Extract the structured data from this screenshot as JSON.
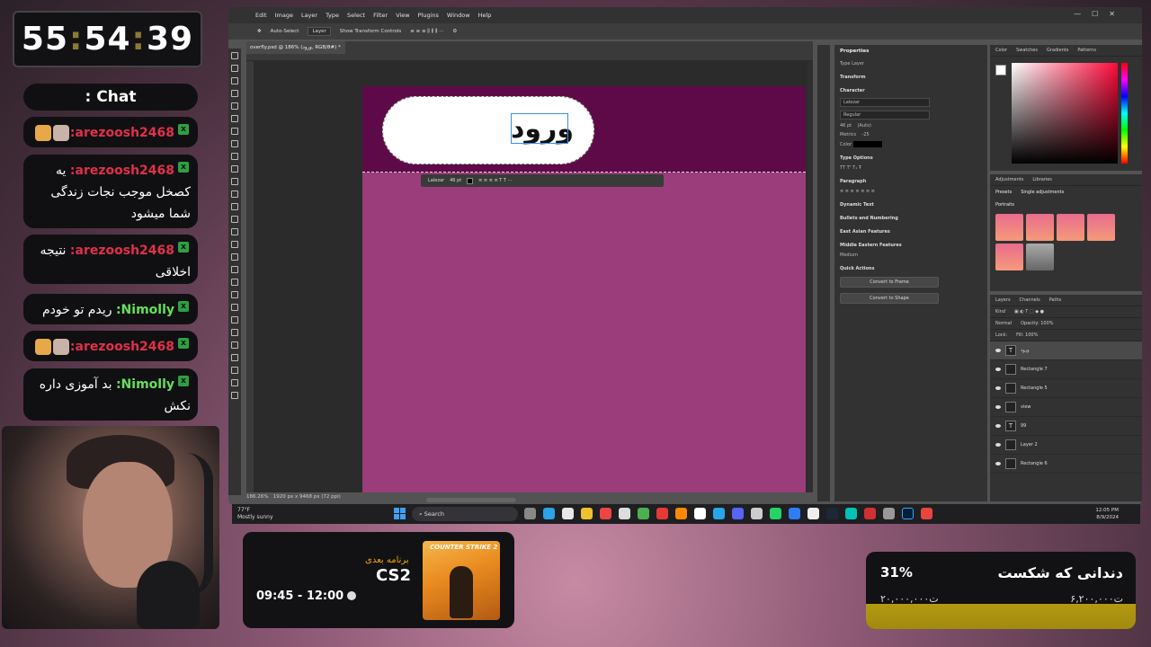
{
  "timer": {
    "h": "55",
    "m": "54",
    "s": "39"
  },
  "chat": {
    "title": ": Chat",
    "messages": [
      {
        "user": "arezoosh2468:",
        "text": "",
        "color": "red",
        "emojis": 2
      },
      {
        "user": "arezoosh2468:",
        "text": "یه کصخل موجب نجات زندگی شما میشود",
        "color": "red",
        "emojis": 0
      },
      {
        "user": "arezoosh2468:",
        "text": "نتیجه اخلاقی",
        "color": "red",
        "emojis": 0
      },
      {
        "user": "Nimolly:",
        "text": "ریدم تو خودم",
        "color": "green",
        "emojis": 0
      },
      {
        "user": "arezoosh2468:",
        "text": "",
        "color": "red",
        "emojis": 2
      },
      {
        "user": "Nimolly:",
        "text": "بد آموزی داره نکش",
        "color": "green",
        "emojis": 0
      }
    ]
  },
  "photoshop": {
    "menu": [
      "Edit",
      "Image",
      "Layer",
      "Type",
      "Select",
      "Filter",
      "View",
      "Plugins",
      "Window",
      "Help"
    ],
    "options": {
      "auto_select": "Auto-Select",
      "layer": "Layer",
      "transform": "Show Transform Controls"
    },
    "doc_tab": "overfly.psd @ 186% (ورود, RGB/8#) *",
    "status_zoom": "186.26%",
    "status_size": "1920 px x 9468 px (72 ppi)",
    "canvas_text": "ورود",
    "ctx_font": "Lalezar",
    "ctx_size": "46 pt",
    "properties": {
      "title": "Properties",
      "type_layer": "Type Layer",
      "transform": "Transform",
      "character": "Character",
      "font": "Lalezar",
      "style": "Regular",
      "size": "46 pt",
      "leading": "(Auto)",
      "kerning": "Metrics",
      "tracking": "-25",
      "color_label": "Color",
      "type_options": "Type Options",
      "paragraph": "Paragraph",
      "dynamic_text": "Dynamic Text",
      "bullets": "Bullets and Numbering",
      "east_asian": "East Asian Features",
      "middle_eastern": "Middle Eastern Features",
      "me_value": "Medium",
      "quick_actions": "Quick Actions",
      "convert_frame": "Convert to Frame",
      "convert_shape": "Convert to Shape"
    },
    "color_tabs": [
      "Color",
      "Swatches",
      "Gradients",
      "Patterns"
    ],
    "adj_tabs": [
      "Adjustments",
      "Libraries"
    ],
    "adj_sub": [
      "Presets",
      "Single adjustments"
    ],
    "portraits_label": "Portraits",
    "layers_tabs": [
      "Layers",
      "Channels",
      "Paths"
    ],
    "layers_kind": "Kind",
    "blend": "Normal",
    "opacity": "Opacity: 100%",
    "fill": "Fill: 100%",
    "lock": "Lock:",
    "layers": [
      {
        "name": "ورود",
        "thumb": "T",
        "active": true
      },
      {
        "name": "Rectangle 7",
        "thumb": "",
        "active": false
      },
      {
        "name": "Rectangle 5",
        "thumb": "",
        "active": false
      },
      {
        "name": "view",
        "thumb": "",
        "active": false
      },
      {
        "name": "99",
        "thumb": "T",
        "active": false
      },
      {
        "name": "Layer 2",
        "thumb": "",
        "active": false
      },
      {
        "name": "Rectangle 6",
        "thumb": "",
        "active": false
      }
    ]
  },
  "taskbar": {
    "temp": "77°F",
    "weather": "Mostly sunny",
    "search": "Search",
    "time": "12:05 PM",
    "date": "8/9/2024"
  },
  "next_program": {
    "label": "برنامه بعدی",
    "game": "CS2",
    "time": "09:45 - 12:00",
    "cover_title": "COUNTER STRIKE 2"
  },
  "goal": {
    "percent": "31%",
    "title": "دندانی که شکست",
    "current": "۶,۲۰۰,۰۰۰ت",
    "target": "۲۰,۰۰۰,۰۰۰ت",
    "progress": 0.31
  }
}
